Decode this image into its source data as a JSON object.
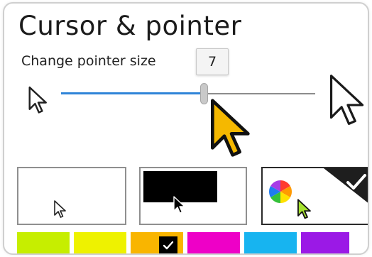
{
  "page": {
    "title": "Cursor & pointer",
    "subtitle": "Change pointer size",
    "slider_value": "7",
    "slider_min": 1,
    "slider_max": 15,
    "slider_fraction": 0.56
  },
  "icons": {
    "small_pointer": "small-pointer-icon",
    "large_pointer": "large-pointer-icon",
    "cursor_preview": "yellow-pointer-icon",
    "selected_check": "checkmark-icon",
    "color_wheel": "color-wheel-icon"
  },
  "pointer_styles": [
    {
      "name": "white",
      "selected": false
    },
    {
      "name": "black",
      "selected": false
    },
    {
      "name": "custom",
      "selected": true
    }
  ],
  "colors": {
    "accent": "#2f84d8",
    "cursor_yellow": "#f5b800",
    "custom_cursor": "#a6e22e",
    "swatches": [
      "#c6ee00",
      "#eef200",
      "#f9b500",
      "#ee00c7",
      "#17b4f0",
      "#9b19e6"
    ],
    "selected_swatch_index": 2
  }
}
